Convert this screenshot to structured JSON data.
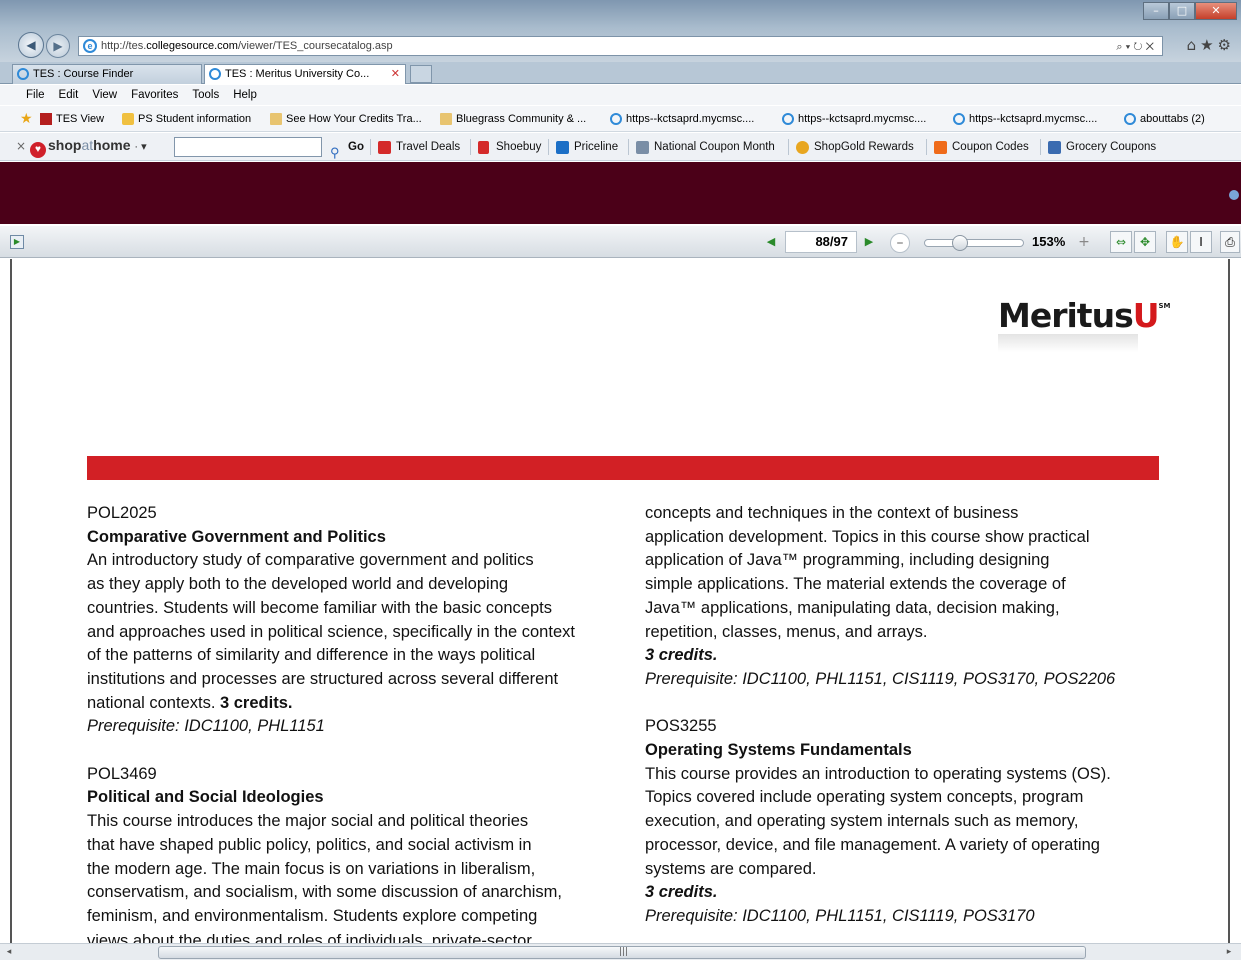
{
  "browser": {
    "url_prefix": "http://tes.",
    "url_domain": "collegesource.com",
    "url_path": "/viewer/TES_coursecatalog.asp",
    "addr_tools": "⌕ ▾ ↻ ✕",
    "window_min": "–",
    "window_max": "□",
    "window_close": "✕",
    "top_icons": "⌂★⚙"
  },
  "tabs": [
    {
      "label": "TES : Course Finder"
    },
    {
      "label": "TES : Meritus University Co...",
      "close": "✕"
    }
  ],
  "menu": [
    "File",
    "Edit",
    "View",
    "Favorites",
    "Tools",
    "Help"
  ],
  "favorites": [
    "TES View",
    "PS Student information",
    "See How Your Credits Tra...",
    "Bluegrass Community & ...",
    "https--kctsaprd.mycmsc....",
    "https--kctsaprd.mycmsc....",
    "https--kctsaprd.mycmsc....",
    "abouttabs (2)"
  ],
  "shop": {
    "close": "×",
    "logo_a": "shop",
    "logo_b": "at",
    "logo_c": "home",
    "logo_caret": "· ▾",
    "search_placeholder": "",
    "go": "Go",
    "items": [
      "Travel Deals",
      "Shoebuy",
      "Priceline",
      "National Coupon Month",
      "ShopGold Rewards",
      "Coupon Codes",
      "Grocery Coupons"
    ]
  },
  "viewer": {
    "page_current": "88",
    "page_total": "/97",
    "zoom": "153%",
    "zoom_level": 0.33,
    "prev": "◀",
    "next": "▶",
    "minus": "–",
    "plus": "+"
  },
  "logo": {
    "main": "Meritus",
    "u": "U",
    "sm": "SM"
  },
  "left_column": {
    "c1_code": "POL2025",
    "c1_title": "Comparative Government and Politics",
    "c1_lines": [
      "An introductory study of comparative government and politics",
      "as they apply both to the developed world and developing",
      "countries. Students will become familiar with the basic concepts",
      "and approaches used in political science, specifically in the context",
      "of the patterns of similarity and difference in the ways political",
      "institutions and processes are structured across several different"
    ],
    "c1_last": "national contexts. ",
    "c1_credits": "3 credits.",
    "c1_prereq": "Prerequisite: IDC1100, PHL1151",
    "c2_code": "POL3469",
    "c2_title": "Political and Social Ideologies",
    "c2_lines": [
      "This course introduces the major social and political theories",
      "that have shaped public policy, politics, and social activism in",
      "the modern age. The main focus is on variations in liberalism,",
      "conservatism, and socialism, with some discussion of anarchism,",
      "feminism, and environmentalism. Students explore competing"
    ],
    "c2_cut": "views about the duties and roles of individuals, private-sector"
  },
  "right_column": {
    "r1_lines": [
      "concepts and techniques in the context of business",
      "application development. Topics in this course show practical",
      "application of Java™ programming, including designing",
      "simple applications. The material extends the coverage of",
      "Java™ applications, manipulating data, decision making,",
      "repetition, classes, menus, and arrays."
    ],
    "r1_credits": "3 credits.",
    "r1_prereq": "Prerequisite: IDC1100, PHL1151, CIS1119, POS3170, POS2206",
    "r2_code": "POS3255",
    "r2_title": "Operating Systems Fundamentals",
    "r2_lines": [
      "This course provides an introduction to operating systems (OS).",
      "Topics covered include operating system concepts, program",
      "execution, and operating system internals such as memory,",
      "processor, device, and file management. A variety of operating",
      "systems are compared."
    ],
    "r2_credits": "3 credits.",
    "r2_prereq": "Prerequisite: IDC1100, PHL1151, CIS1119, POS3170"
  },
  "scroll": {
    "left": "◂",
    "right": "▸",
    "grip": "|||"
  }
}
